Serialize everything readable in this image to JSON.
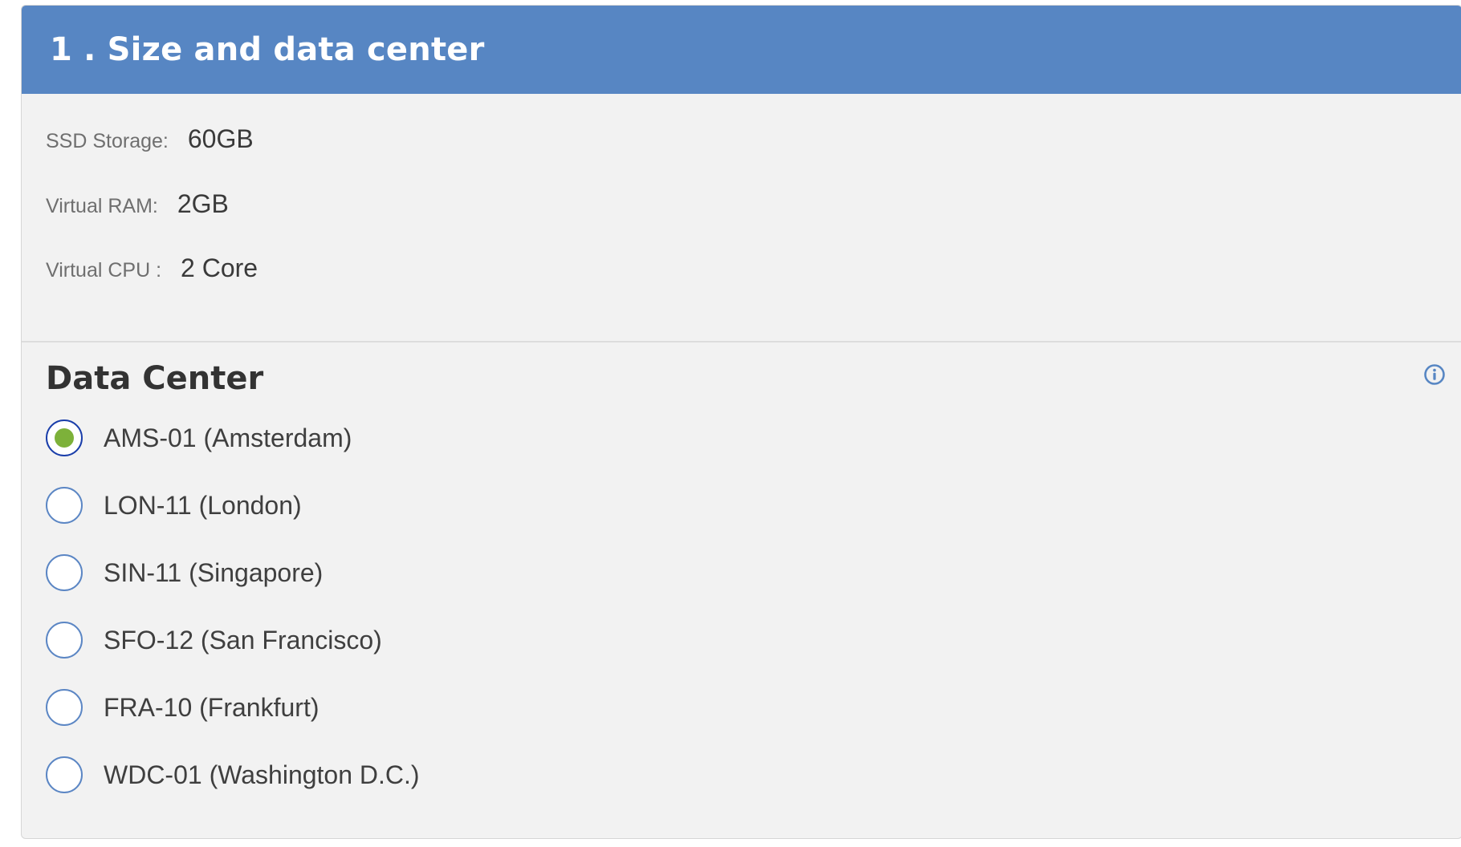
{
  "panel": {
    "title": "1 . Size and data center"
  },
  "specs": [
    {
      "label": "SSD Storage:",
      "value": "60GB"
    },
    {
      "label": "Virtual RAM:",
      "value": "2GB"
    },
    {
      "label": "Virtual CPU :",
      "value": "2 Core"
    }
  ],
  "data_center": {
    "title": "Data Center",
    "info_icon": "info-icon",
    "selected": "AMS-01 (Amsterdam)",
    "options": [
      {
        "label": "AMS-01 (Amsterdam)",
        "checked": true
      },
      {
        "label": "LON-11 (London)",
        "checked": false
      },
      {
        "label": "SIN-11 (Singapore)",
        "checked": false
      },
      {
        "label": "SFO-12 (San Francisco)",
        "checked": false
      },
      {
        "label": "FRA-10 (Frankfurt)",
        "checked": false
      },
      {
        "label": "WDC-01 (Washington D.C.)",
        "checked": false
      }
    ]
  },
  "colors": {
    "header_bg": "#5786c3",
    "panel_bg": "#f2f2f2",
    "radio_border": "#5b86c4",
    "radio_selected_border": "#1a3eaa",
    "radio_selected_dot": "#7db13a",
    "info_icon": "#5786c3"
  }
}
